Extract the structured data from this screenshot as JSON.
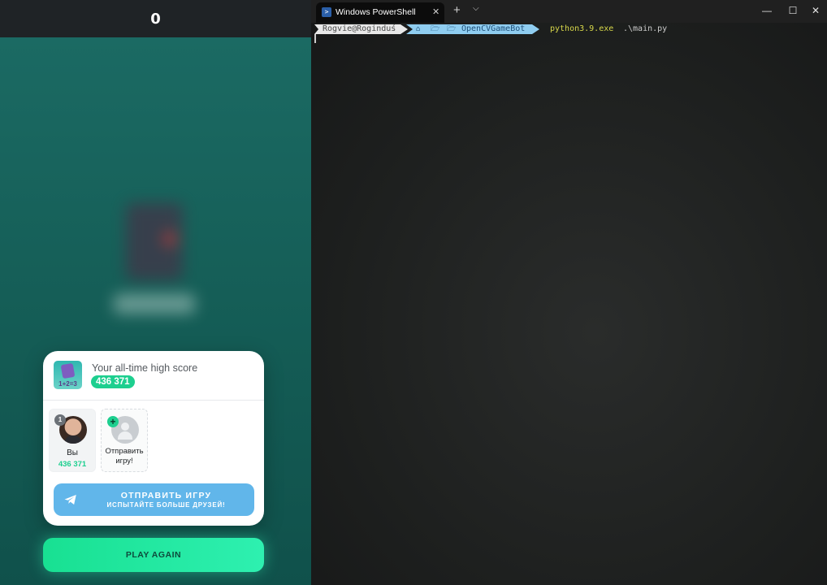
{
  "game": {
    "score": "0",
    "high_score_label": "Your all-time high score",
    "high_score_value": "436 371",
    "game_icon_label": "1+2=3",
    "friends": [
      {
        "rank": "1",
        "name": "Вы",
        "score": "436 371"
      }
    ],
    "invite": {
      "plus": "+",
      "label_line1": "Отправить",
      "label_line2": "игру!"
    },
    "send_button": {
      "title": "ОТПРАВИТЬ ИГРУ",
      "subtitle": "ИСПЫТАЙТЕ БОЛЬШЕ ДРУЗЕЙ!"
    },
    "play_again": "PLAY AGAIN",
    "colors": {
      "accent_green": "#1dcf8f",
      "telegram_blue": "#61b6ea",
      "background": "#145c55"
    }
  },
  "terminal": {
    "tab_title": "Windows PowerShell",
    "tab_close": "✕",
    "new_tab": "+",
    "dropdown": "⌵",
    "window_controls": {
      "minimize": "—",
      "maximize": "☐",
      "close": "✕"
    },
    "prompt": {
      "user": "Rogvie@Roginduś",
      "home_icon": "⌂",
      "folder_icon": "🗁",
      "dir": "OpenCVGameBot",
      "command": "python3.9.exe",
      "argument": ".\\main.py"
    }
  }
}
